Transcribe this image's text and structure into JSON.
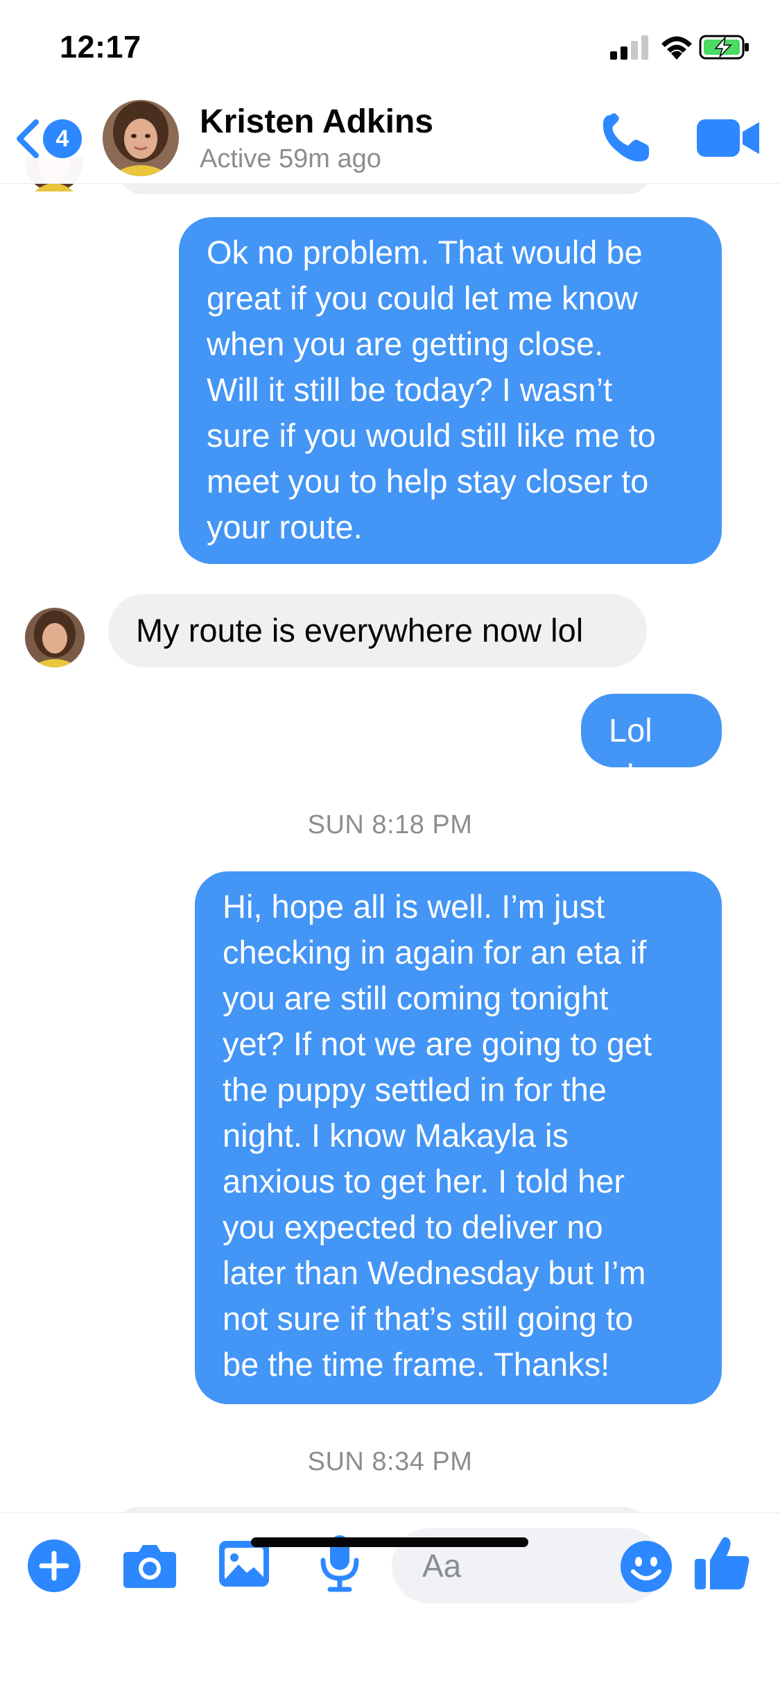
{
  "status_bar": {
    "time": "12:17",
    "battery_state": "charging",
    "accent": "#4cd964"
  },
  "header": {
    "back_badge": "4",
    "contact_name": "Kristen Adkins",
    "contact_status": "Active 59m ago",
    "icons": [
      "back-chevron-icon",
      "phone-icon",
      "video-camera-icon"
    ],
    "accent": "#2d88ff"
  },
  "messages": [
    {
      "direction": "outgoing",
      "lines": [
        "Ok no problem. That would be",
        "great if you could let me know",
        "when you are getting close.",
        "Will it still be today? I wasn’t",
        "sure if you would still like me to",
        "meet you to help stay closer to",
        "your route."
      ]
    },
    {
      "direction": "incoming",
      "lines": [
        "My route is everywhere now lol"
      ]
    },
    {
      "direction": "outgoing",
      "lines": [
        "Lol ok"
      ]
    },
    {
      "timestamp": "SUN 8:18 PM"
    },
    {
      "direction": "outgoing",
      "lines": [
        "Hi, hope all is well. I’m just",
        "checking in again for an eta if",
        "you are still coming tonight",
        "yet? If not we are going to get",
        "the puppy settled in for the",
        "night. I know Makayla is",
        "anxious to get her. I told her",
        "you expected to deliver no",
        "later than Wednesday but I’m",
        "not sure if that’s still going to",
        "be the time frame. Thanks!"
      ]
    },
    {
      "timestamp": "SUN 8:34 PM"
    }
  ],
  "composer": {
    "placeholder": "Aa",
    "icons": [
      "plus-icon",
      "camera-icon",
      "photo-icon",
      "microphone-icon",
      "emoji-icon",
      "thumbs-up-icon"
    ]
  },
  "colors": {
    "outgoing_bubble": "#4395f6",
    "incoming_bubble": "#f0f0f0",
    "icon_blue": "#2d88ff"
  }
}
